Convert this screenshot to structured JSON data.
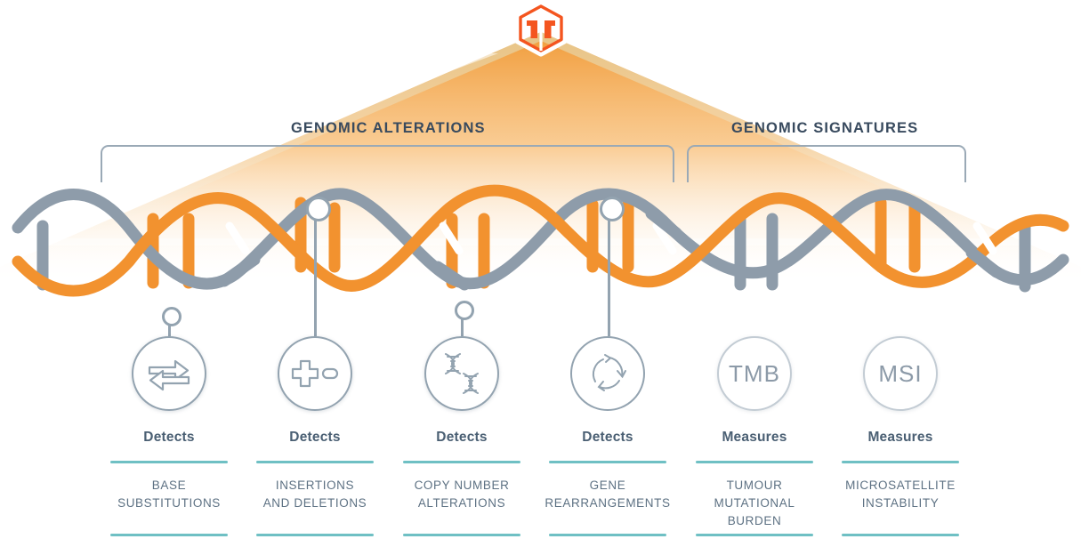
{
  "logo": {
    "name": "company-hexagon-logo",
    "color": "#f4551f"
  },
  "sections": [
    {
      "id": "alterations",
      "label": "GENOMIC ALTERATIONS"
    },
    {
      "id": "signatures",
      "label": "GENOMIC SIGNATURES"
    }
  ],
  "colors": {
    "orange": "#f2922f",
    "gray_strand": "#8e9caa",
    "teal_divider": "#6fc0c4",
    "title_navy": "#384a5e",
    "label_slate": "#5d7183",
    "bracket": "#9aa9b6"
  },
  "columns": [
    {
      "icon": "swap-arrows-icon",
      "icon_label": "",
      "verb": "Detects",
      "description": "BASE\nSUBSTITUTIONS"
    },
    {
      "icon": "plus-minus-icon",
      "icon_label": "",
      "verb": "Detects",
      "description": "INSERTIONS\nAND DELETIONS"
    },
    {
      "icon": "dna-double-helix-icon",
      "icon_label": "",
      "verb": "Detects",
      "description": "COPY NUMBER\nALTERATIONS"
    },
    {
      "icon": "circular-arrows-icon",
      "icon_label": "",
      "verb": "Detects",
      "description": "GENE\nREARRANGEMENTS"
    },
    {
      "icon": "tmb-text-icon",
      "icon_label": "TMB",
      "verb": "Measures",
      "description": "TUMOUR\nMUTATIONAL\nBURDEN"
    },
    {
      "icon": "msi-text-icon",
      "icon_label": "MSI",
      "verb": "Measures",
      "description": "MICROSATELLITE\nINSTABILITY"
    }
  ]
}
